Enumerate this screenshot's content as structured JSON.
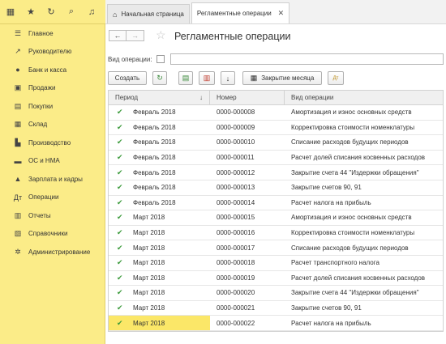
{
  "sidebar": {
    "items": [
      {
        "icon": "menu-icon",
        "glyph": "☰",
        "label": "Главное"
      },
      {
        "icon": "trend-icon",
        "glyph": "↗",
        "label": "Руководителю"
      },
      {
        "icon": "coin-icon",
        "glyph": "●",
        "label": "Банк и касса"
      },
      {
        "icon": "bag-icon",
        "glyph": "▣",
        "label": "Продажи"
      },
      {
        "icon": "cart-icon",
        "glyph": "▤",
        "label": "Покупки"
      },
      {
        "icon": "warehouse-icon",
        "glyph": "▦",
        "label": "Склад"
      },
      {
        "icon": "factory-icon",
        "glyph": "▙",
        "label": "Производство"
      },
      {
        "icon": "truck-icon",
        "glyph": "▬",
        "label": "ОС и НМА"
      },
      {
        "icon": "person-icon",
        "glyph": "▲",
        "label": "Зарплата и кадры"
      },
      {
        "icon": "dt-kt-icon",
        "glyph": "Дт",
        "label": "Операции"
      },
      {
        "icon": "bar-chart-icon",
        "glyph": "▥",
        "label": "Отчеты"
      },
      {
        "icon": "books-icon",
        "glyph": "▧",
        "label": "Справочники"
      },
      {
        "icon": "gear-icon",
        "glyph": "✲",
        "label": "Администрирование"
      }
    ]
  },
  "tabs": {
    "home": "Начальная страница",
    "active": "Регламентные операции"
  },
  "header": {
    "title": "Регламентные операции"
  },
  "filter": {
    "label": "Вид операции:"
  },
  "toolbar": {
    "create": "Создать",
    "close_month": "Закрытие месяца"
  },
  "table": {
    "columns": [
      "Период",
      "Номер",
      "Вид операции"
    ],
    "rows": [
      {
        "period": "Февраль 2018",
        "number": "0000-000008",
        "op": "Амортизация и износ основных средств"
      },
      {
        "period": "Февраль 2018",
        "number": "0000-000009",
        "op": "Корректировка стоимости номенклатуры"
      },
      {
        "period": "Февраль 2018",
        "number": "0000-000010",
        "op": "Списание расходов будущих периодов"
      },
      {
        "period": "Февраль 2018",
        "number": "0000-000011",
        "op": "Расчет долей списания косвенных расходов"
      },
      {
        "period": "Февраль 2018",
        "number": "0000-000012",
        "op": "Закрытие счета 44 \"Издержки обращения\""
      },
      {
        "period": "Февраль 2018",
        "number": "0000-000013",
        "op": "Закрытие счетов 90, 91"
      },
      {
        "period": "Февраль 2018",
        "number": "0000-000014",
        "op": "Расчет налога на прибыль"
      },
      {
        "period": "Март 2018",
        "number": "0000-000015",
        "op": "Амортизация и износ основных средств"
      },
      {
        "period": "Март 2018",
        "number": "0000-000016",
        "op": "Корректировка стоимости номенклатуры"
      },
      {
        "period": "Март 2018",
        "number": "0000-000017",
        "op": "Списание расходов будущих периодов"
      },
      {
        "period": "Март 2018",
        "number": "0000-000018",
        "op": "Расчет транспортного налога"
      },
      {
        "period": "Март 2018",
        "number": "0000-000019",
        "op": "Расчет долей списания косвенных расходов"
      },
      {
        "period": "Март 2018",
        "number": "0000-000020",
        "op": "Закрытие счета 44 \"Издержки обращения\""
      },
      {
        "period": "Март 2018",
        "number": "0000-000021",
        "op": "Закрытие счетов 90, 91"
      },
      {
        "period": "Март 2018",
        "number": "0000-000022",
        "op": "Расчет налога на прибыль"
      }
    ],
    "selected_index": 14
  },
  "colors": {
    "sidebar_bg": "#fbec88",
    "selected_row": "#fbe768",
    "check": "#3a9a3a"
  }
}
